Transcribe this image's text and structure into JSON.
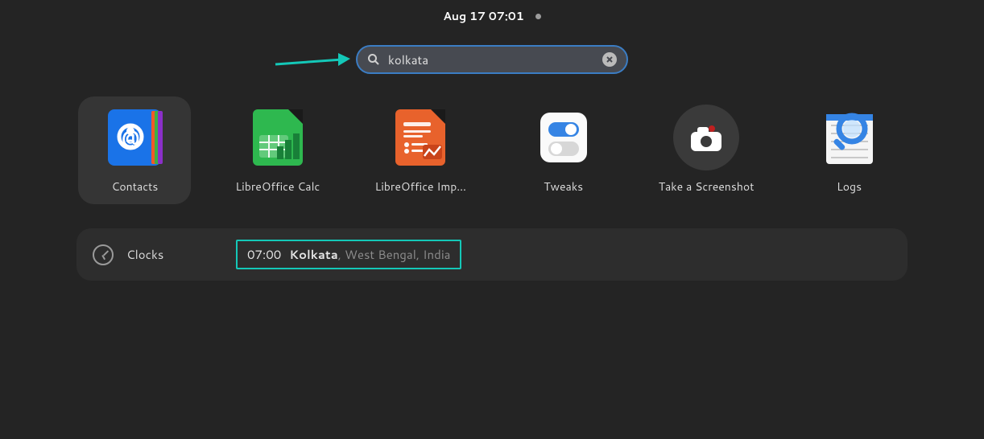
{
  "topbar": {
    "datetime": "Aug 17  07:01"
  },
  "search": {
    "value": "kolkata"
  },
  "apps": [
    {
      "name": "Contacts",
      "id": "contacts",
      "selected": true
    },
    {
      "name": "LibreOffice Calc",
      "id": "calc",
      "selected": false
    },
    {
      "name": "LibreOffice Imp…",
      "id": "impress",
      "selected": false
    },
    {
      "name": "Tweaks",
      "id": "tweaks",
      "selected": false
    },
    {
      "name": "Take a Screenshot",
      "id": "screenshot",
      "selected": false
    },
    {
      "name": "Logs",
      "id": "logs",
      "selected": false
    }
  ],
  "clocks": {
    "provider": "Clocks",
    "time": "07:00",
    "city": "Kolkata",
    "location": ", West Bengal, India"
  },
  "annotation": {
    "arrow_color": "#14c8b8"
  }
}
